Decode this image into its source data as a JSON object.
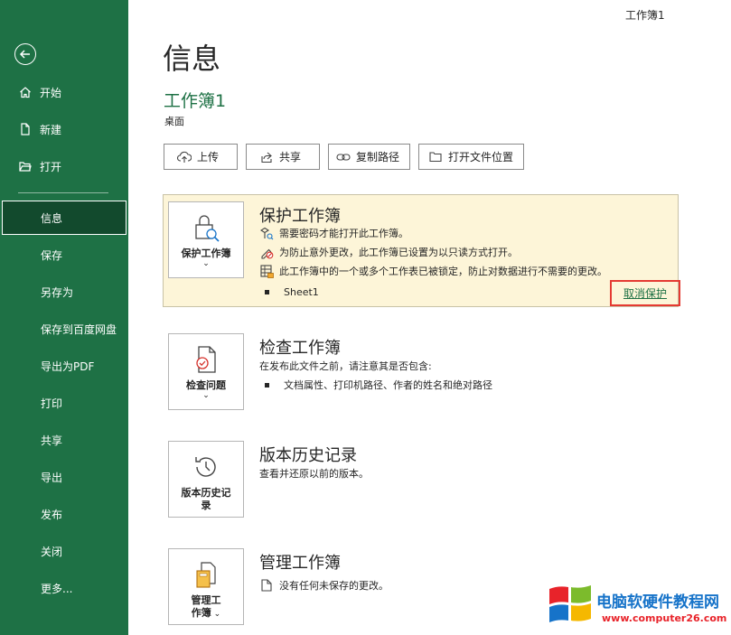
{
  "window": {
    "title": "工作簿1"
  },
  "sidebar": {
    "top_items": [
      {
        "label": "开始",
        "icon": "home-icon"
      },
      {
        "label": "新建",
        "icon": "new-document-icon"
      },
      {
        "label": "打开",
        "icon": "folder-open-icon"
      }
    ],
    "items": [
      {
        "label": "信息",
        "active": true
      },
      {
        "label": "保存"
      },
      {
        "label": "另存为"
      },
      {
        "label": "保存到百度网盘"
      },
      {
        "label": "导出为PDF"
      },
      {
        "label": "打印"
      },
      {
        "label": "共享"
      },
      {
        "label": "导出"
      },
      {
        "label": "发布"
      },
      {
        "label": "关闭"
      },
      {
        "label": "更多..."
      }
    ],
    "accent_color": "#1e7145"
  },
  "header": {
    "title": "信息",
    "workbook_name": "工作簿1",
    "location": "桌面"
  },
  "actions": [
    {
      "label": "上传",
      "icon": "cloud-upload-icon"
    },
    {
      "label": "共享",
      "icon": "share-icon"
    },
    {
      "label": "复制路径",
      "icon": "link-icon"
    },
    {
      "label": "打开文件位置",
      "icon": "folder-icon"
    }
  ],
  "protect": {
    "tile_label": "保护工作簿",
    "title": "保护工作簿",
    "lines": [
      "需要密码才能打开此工作簿。",
      "为防止意外更改，此工作簿已设置为以只读方式打开。",
      "此工作簿中的一个或多个工作表已被锁定，防止对数据进行不需要的更改。"
    ],
    "sheet": "Sheet1",
    "unprotect_label": "取消保护",
    "panel_color": "#fdf5d8"
  },
  "inspect": {
    "tile_label": "检查问题",
    "title": "检查工作簿",
    "desc": "在发布此文件之前，请注意其是否包含:",
    "bullet": "文档属性、打印机路径、作者的姓名和绝对路径"
  },
  "history": {
    "tile_label_1": "版本历史记",
    "tile_label_2": "录",
    "title": "版本历史记录",
    "desc": "查看并还原以前的版本。"
  },
  "manage": {
    "tile_label_1": "管理工",
    "tile_label_2": "作簿",
    "title": "管理工作簿",
    "desc": "没有任何未保存的更改。"
  },
  "watermark": {
    "title": "电脑软硬件教程网",
    "url": "www.computer26.com"
  }
}
